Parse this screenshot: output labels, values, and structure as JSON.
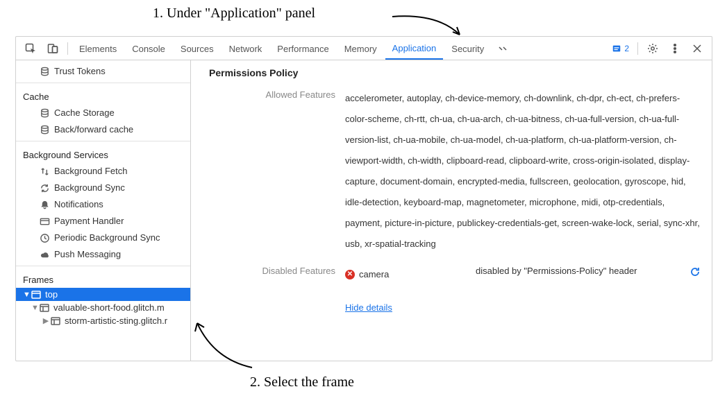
{
  "annotations": {
    "step1": "1. Under \"Application\" panel",
    "step2": "2. Select the frame"
  },
  "toolbar": {
    "tabs": [
      "Elements",
      "Console",
      "Sources",
      "Network",
      "Performance",
      "Memory",
      "Application",
      "Security"
    ],
    "active_tab_index": 6,
    "issues_count": "2"
  },
  "sidebar": {
    "trust_tokens": "Trust Tokens",
    "cache": {
      "title": "Cache",
      "items": [
        "Cache Storage",
        "Back/forward cache"
      ]
    },
    "bg": {
      "title": "Background Services",
      "items": [
        "Background Fetch",
        "Background Sync",
        "Notifications",
        "Payment Handler",
        "Periodic Background Sync",
        "Push Messaging"
      ]
    },
    "frames": {
      "title": "Frames",
      "top": "top",
      "child1": "valuable-short-food.glitch.m",
      "child2": "storm-artistic-sting.glitch.r"
    }
  },
  "panel": {
    "title": "Permissions Policy",
    "allowed_label": "Allowed Features",
    "allowed_value": "accelerometer, autoplay, ch-device-memory, ch-downlink, ch-dpr, ch-ect, ch-prefers-color-scheme, ch-rtt, ch-ua, ch-ua-arch, ch-ua-bitness, ch-ua-full-version, ch-ua-full-version-list, ch-ua-mobile, ch-ua-model, ch-ua-platform, ch-ua-platform-version, ch-viewport-width, ch-width, clipboard-read, clipboard-write, cross-origin-isolated, display-capture, document-domain, encrypted-media, fullscreen, geolocation, gyroscope, hid, idle-detection, keyboard-map, magnetometer, microphone, midi, otp-credentials, payment, picture-in-picture, publickey-credentials-get, screen-wake-lock, serial, sync-xhr, usb, xr-spatial-tracking",
    "disabled_label": "Disabled Features",
    "disabled_feature": "camera",
    "disabled_reason": "disabled by \"Permissions-Policy\" header",
    "hide_details": "Hide details"
  }
}
